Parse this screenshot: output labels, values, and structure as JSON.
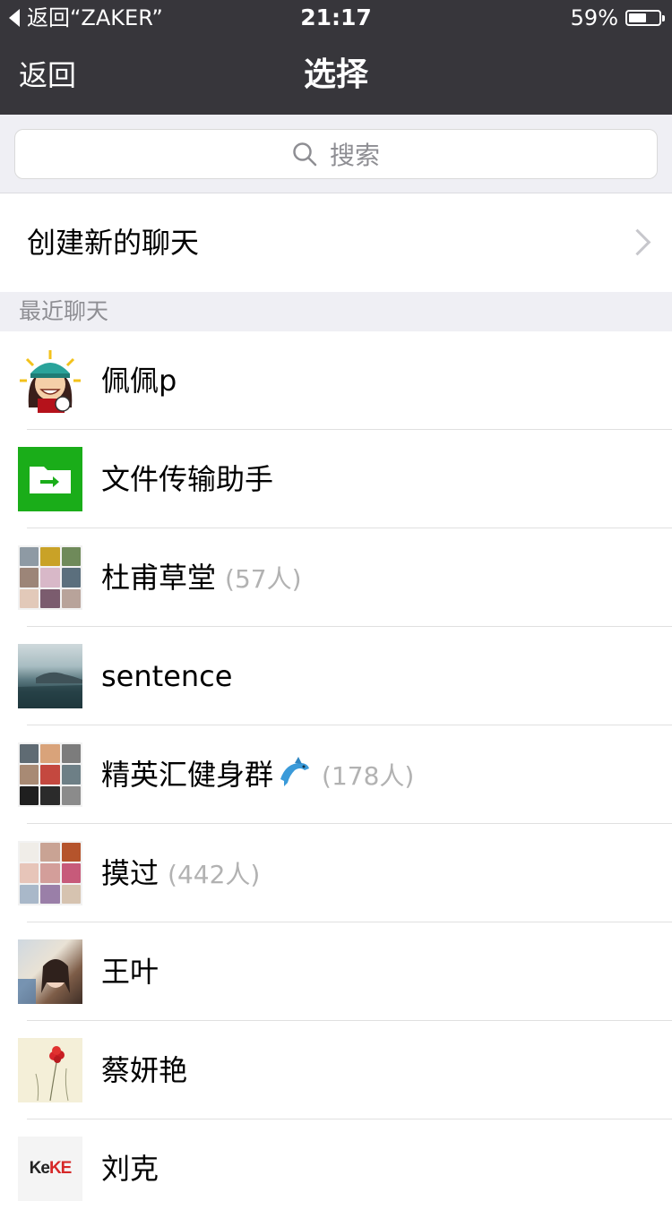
{
  "status_bar": {
    "back_app": "返回“ZAKER”",
    "time": "21:17",
    "battery_text": "59%",
    "battery_level": 0.59
  },
  "nav": {
    "back_label": "返回",
    "title": "选择"
  },
  "search": {
    "placeholder": "搜索",
    "icon": "search-icon"
  },
  "new_chat": {
    "label": "创建新的聊天",
    "icon": "chevron-right-icon"
  },
  "recent_section": {
    "title": "最近聊天"
  },
  "chats": [
    {
      "name": "佩佩p",
      "count": ""
    },
    {
      "name": "文件传输助手",
      "count": ""
    },
    {
      "name": "杜甫草堂",
      "count": "(57人)"
    },
    {
      "name": "sentence",
      "count": ""
    },
    {
      "name": "精英汇健身群",
      "count": "(178人)",
      "emoji": "dolphin"
    },
    {
      "name": "摸过",
      "count": "(442人)"
    },
    {
      "name": "王叶",
      "count": ""
    },
    {
      "name": "蔡妍艳",
      "count": ""
    },
    {
      "name": "刘克",
      "count": ""
    }
  ],
  "logos": {
    "keke": "KeKE"
  },
  "colors": {
    "nav_background": "#37363b",
    "file_helper_green": "#1aad19",
    "section_background": "#efeff4",
    "count_gray": "#b2b2b2"
  }
}
